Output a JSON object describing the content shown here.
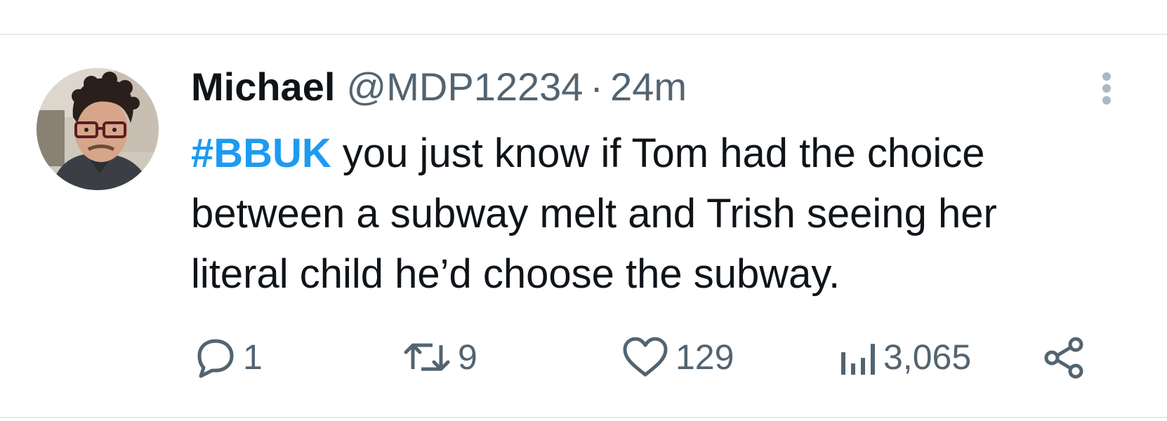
{
  "tweet": {
    "author": {
      "name": "Michael",
      "handle": "@MDP12234",
      "avatar_icon": "profile-photo"
    },
    "separator": "·",
    "time": "24m",
    "hashtag": "#BBUK",
    "text_lines": [
      " you just know if Tom had the choice",
      "between a subway melt and Trish seeing her",
      "literal child he’d choose the subway."
    ],
    "actions": {
      "reply": {
        "icon": "reply-icon",
        "count": "1"
      },
      "repost": {
        "icon": "repost-icon",
        "count": "9"
      },
      "like": {
        "icon": "heart-icon",
        "count": "129"
      },
      "views": {
        "icon": "views-icon",
        "count": "3,065"
      },
      "share": {
        "icon": "share-icon"
      }
    },
    "more_icon": "more-vertical-icon"
  },
  "colors": {
    "text": "#0f1419",
    "secondary": "#536471",
    "link": "#1d9bf0",
    "divider": "#e7e9eb",
    "background": "#ffffff"
  }
}
